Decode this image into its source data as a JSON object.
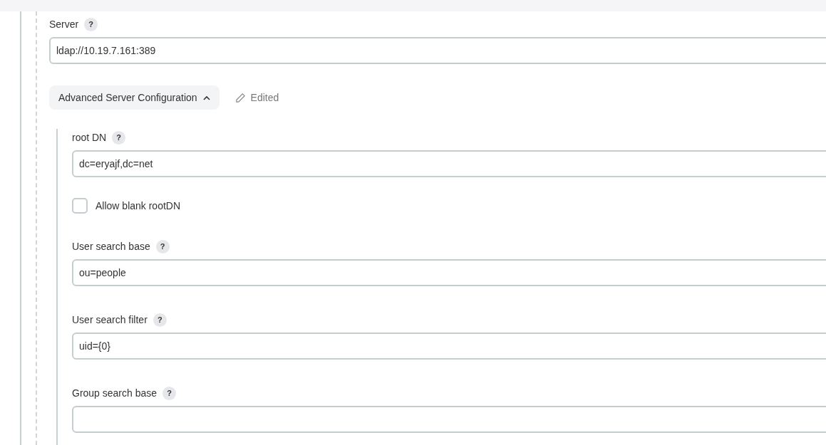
{
  "server": {
    "label": "Server",
    "help": "?",
    "value": "ldap://10.19.7.161:389"
  },
  "advanced": {
    "label": "Advanced Server Configuration",
    "expanded": true,
    "status": "Edited"
  },
  "fields": [
    {
      "kind": "text",
      "label": "root DN",
      "help": "?",
      "value": "dc=eryajf,dc=net"
    },
    {
      "kind": "checkbox",
      "label": "Allow blank rootDN",
      "checked": false
    },
    {
      "kind": "text",
      "label": "User search base",
      "help": "?",
      "value": "ou=people"
    },
    {
      "kind": "text",
      "label": "User search filter",
      "help": "?",
      "value": "uid={0}"
    },
    {
      "kind": "text",
      "label": "Group search base",
      "help": "?"
    }
  ]
}
